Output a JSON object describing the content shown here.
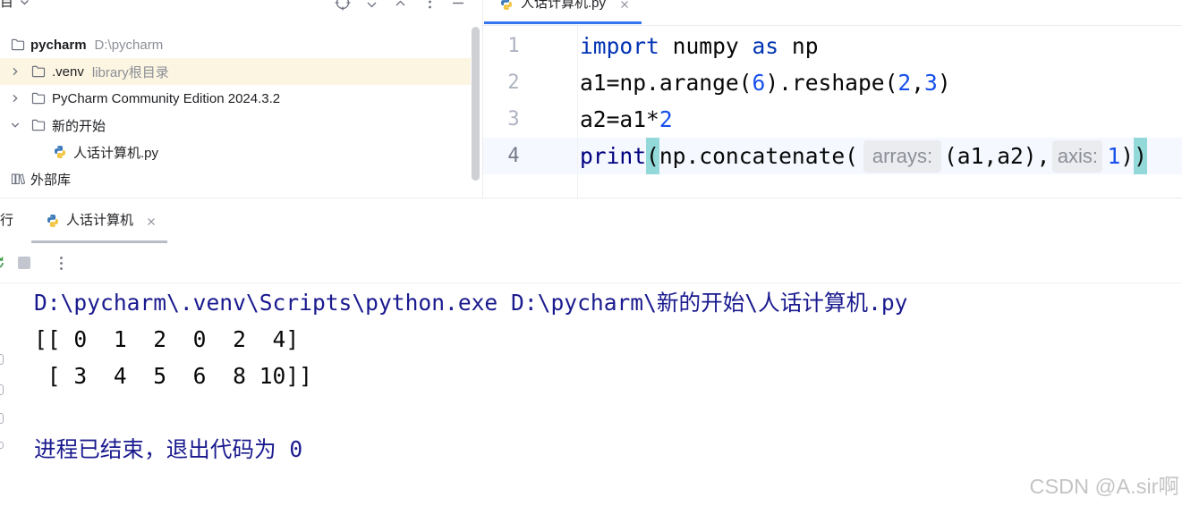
{
  "project_panel": {
    "title": "目",
    "tree": [
      {
        "name": "pycharm",
        "path": "D:\\pycharm"
      },
      {
        "name": ".venv",
        "note": "library根目录"
      },
      {
        "name": "PyCharm Community Edition 2024.3.2"
      },
      {
        "name": "新的开始"
      },
      {
        "name": "人话计算机.py"
      },
      {
        "name": "外部库"
      }
    ]
  },
  "editor": {
    "tab_label": "人话计算机.py",
    "line_numbers": [
      "1",
      "2",
      "3",
      "4"
    ],
    "lines": [
      [
        "import",
        " numpy ",
        "as",
        " np"
      ],
      [
        "a1=np.arange(",
        "6",
        ").reshape(",
        "2",
        ",",
        "3",
        ")"
      ],
      [
        "a2=a1*",
        "2"
      ],
      [
        "print",
        "(",
        "np.concatenate(",
        "arrays:",
        "(a1,a2),",
        "axis:",
        "1",
        ")",
        ")"
      ]
    ]
  },
  "run_panel": {
    "title": "行",
    "tab_label": "人话计算机",
    "command": "D:\\pycharm\\.venv\\Scripts\\python.exe D:\\pycharm\\新的开始\\人话计算机.py",
    "output": [
      "[[ 0  1  2  0  2  4]",
      " [ 3  4  5  6  8 10]]"
    ],
    "exit_message": "进程已结束，退出代码为 0"
  },
  "watermark": "CSDN @A.sir啊",
  "colors": {
    "keyword": "#0033b3",
    "number": "#1750eb",
    "builtin": "#000080",
    "paren_match": "#93d9d9",
    "tab_accent": "#3574f0",
    "current_line": "#f5f8fe",
    "library_row_bg": "#fcf5e2",
    "console_system": "#1a1a8f",
    "run_green": "#3c9a4a"
  },
  "icons": [
    "folder-icon",
    "python-file-icon",
    "chevron-right-icon",
    "chevron-down-icon",
    "library-icon",
    "locate-icon",
    "chevron-up-icon",
    "more-vertical-icon",
    "minimize-icon",
    "close-icon",
    "rerun-icon",
    "stop-icon"
  ]
}
